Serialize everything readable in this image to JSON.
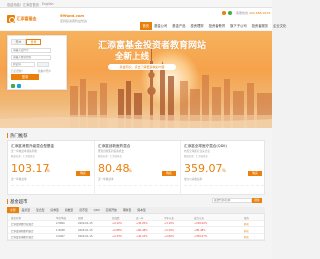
{
  "topbar": {
    "welcome": "欢迎光临！汇添富首页",
    "lang": "English"
  },
  "header": {
    "logo_text": "汇添富基金",
    "site_url": "99fund.com",
    "slogan": "坚持投资者利益优先",
    "hotline_label": "客服热线",
    "hotline": "400-888-9918"
  },
  "nav": [
    "首页",
    "基金公司",
    "基金产品",
    "投资理财",
    "投资者教育",
    "旗下子公司",
    "投资者服务",
    "企业文化"
  ],
  "banner": {
    "title": "汇添富基金投资者教育网站",
    "subtitle": "全新上线",
    "pill": "基金知识，点击了解更多精彩内容"
  },
  "login": {
    "tabs": [
      "开户",
      "登录"
    ],
    "account_placeholder": "请输入证件号",
    "password_placeholder": "请输入交易密码",
    "code_placeholder": "验证码",
    "button": "登录",
    "forgot": "忘记密码？",
    "register": "新用户开户"
  },
  "hot": {
    "title": "热门推荐",
    "cards": [
      {
        "name": "汇添富消费升级混合型基金",
        "desc": "近一年收益率领先同类",
        "note": "数据来源：汇添富基金",
        "value": "103.17",
        "unit": "%",
        "label": "近一年收益率",
        "button": "购买"
      },
      {
        "name": "汇添富创新医药混合",
        "desc": "聚焦创新医药投资机会",
        "note": "数据来源：汇添富基金",
        "value": "80.48",
        "unit": "%",
        "label": "近一年收益率",
        "button": "购买"
      },
      {
        "name": "汇添富全球医疗混合(QDII)",
        "desc": "布局全球医疗龙头企业",
        "note": "数据来源：汇添富基金",
        "value": "359.07",
        "unit": "%",
        "label": "成立以来收益率",
        "button": "购买"
      }
    ]
  },
  "funds": {
    "title": "基金超市",
    "search_placeholder": "基金代码/名称",
    "search_button": "搜索",
    "tabs": [
      "全部",
      "股票型",
      "混合型",
      "债券型",
      "指数型",
      "货币型",
      "QDII",
      "定期开放",
      "理财型",
      "保本型"
    ],
    "columns": [
      "基金名称",
      "单位净值",
      "日期",
      "日涨跌",
      "近一年",
      "今年以来",
      "成立以来",
      "操作"
    ],
    "rows": [
      {
        "name": "汇添富消费行业混合",
        "nav": "2.5800",
        "date": "2020-01-15",
        "day": "+0.12%",
        "year": "+45.20%",
        "ytd": "+3.10%",
        "since": "+158.00%",
        "op": "购买"
      },
      {
        "name": "汇添富创新医药混合",
        "nav": "1.8048",
        "date": "2020-01-15",
        "day": "+0.86%",
        "year": "+80.48%",
        "ytd": "+5.20%",
        "since": "+80.48%",
        "op": "购买"
      },
      {
        "name": "汇添富全球医疗混合",
        "nav": "4.5907",
        "date": "2020-01-15",
        "day": "+0.33%",
        "year": "+40.10%",
        "ytd": "+2.80%",
        "since": "+359.07%",
        "op": "购买"
      }
    ]
  },
  "colors": {
    "accent": "#e9800c",
    "up": "#ee3333"
  }
}
